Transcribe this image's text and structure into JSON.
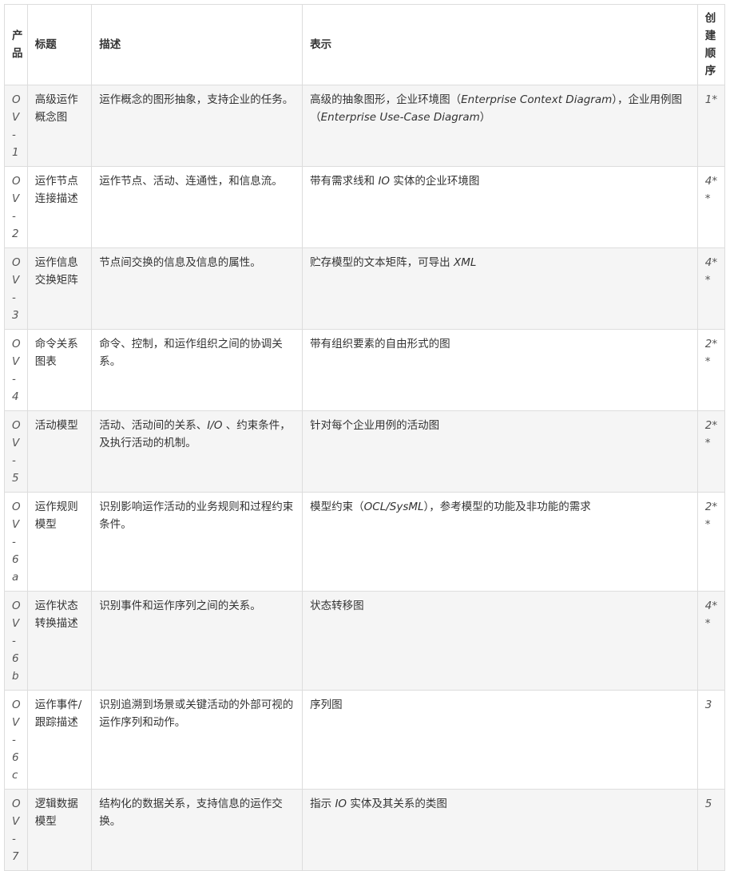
{
  "table": {
    "headers": {
      "product": "产品",
      "title": "标题",
      "description": "描述",
      "representation": "表示",
      "order": "创建顺序"
    },
    "rows": [
      {
        "id": "OV-1",
        "title": "高级运作概念图",
        "description": "运作概念的图形抽象，支持企业的任务。",
        "rep": [
          {
            "t": "高级的抽象图形，企业环境图（",
            "i": false
          },
          {
            "t": "Enterprise Context Diagram",
            "i": true
          },
          {
            "t": "），企业用例图（",
            "i": false
          },
          {
            "t": "Enterprise Use-Case Diagram",
            "i": true
          },
          {
            "t": "）",
            "i": false
          }
        ],
        "order": "1*"
      },
      {
        "id": "OV-2",
        "title": "运作节点连接描述",
        "description": "运作节点、活动、连通性，和信息流。",
        "rep": [
          {
            "t": "带有需求线和 ",
            "i": false
          },
          {
            "t": "IO",
            "i": true
          },
          {
            "t": " 实体的企业环境图",
            "i": false
          }
        ],
        "order": "4**"
      },
      {
        "id": "OV-3",
        "title": "运作信息交换矩阵",
        "description": "节点间交换的信息及信息的属性。",
        "rep": [
          {
            "t": "贮存模型的文本矩阵，可导出 ",
            "i": false
          },
          {
            "t": "XML",
            "i": true
          }
        ],
        "order": "4**"
      },
      {
        "id": "OV-4",
        "title": "命令关系图表",
        "description": "命令、控制，和运作组织之间的协调关系。",
        "rep": [
          {
            "t": "带有组织要素的自由形式的图",
            "i": false
          }
        ],
        "order": "2**"
      },
      {
        "id": "OV-5",
        "title": "活动模型",
        "description_parts": [
          {
            "t": "活动、活动间的关系、",
            "i": false
          },
          {
            "t": "I/O",
            "i": true
          },
          {
            "t": " 、约束条件，及执行活动的机制。",
            "i": false
          }
        ],
        "rep": [
          {
            "t": "针对每个企业用例的活动图",
            "i": false
          }
        ],
        "order": "2**"
      },
      {
        "id": "OV-6a",
        "title": "运作规则模型",
        "description": "识别影响运作活动的业务规则和过程约束条件。",
        "rep": [
          {
            "t": "模型约束（",
            "i": false
          },
          {
            "t": "OCL/SysML",
            "i": true
          },
          {
            "t": "），参考模型的功能及非功能的需求",
            "i": false
          }
        ],
        "order": "2**"
      },
      {
        "id": "OV-6b",
        "title": "运作状态转换描述",
        "description": "识别事件和运作序列之间的关系。",
        "rep": [
          {
            "t": "状态转移图",
            "i": false
          }
        ],
        "order": "4**"
      },
      {
        "id": "OV-6c",
        "title": "运作事件/跟踪描述",
        "description": "识别追溯到场景或关键活动的外部可视的运作序列和动作。",
        "rep": [
          {
            "t": "序列图",
            "i": false
          }
        ],
        "order": "3"
      },
      {
        "id": "OV-7",
        "title": "逻辑数据模型",
        "description": "结构化的数据关系，支持信息的运作交换。",
        "rep": [
          {
            "t": "指示 ",
            "i": false
          },
          {
            "t": "IO",
            "i": true
          },
          {
            "t": " 实体及其关系的类图",
            "i": false
          }
        ],
        "order": "5"
      }
    ]
  }
}
